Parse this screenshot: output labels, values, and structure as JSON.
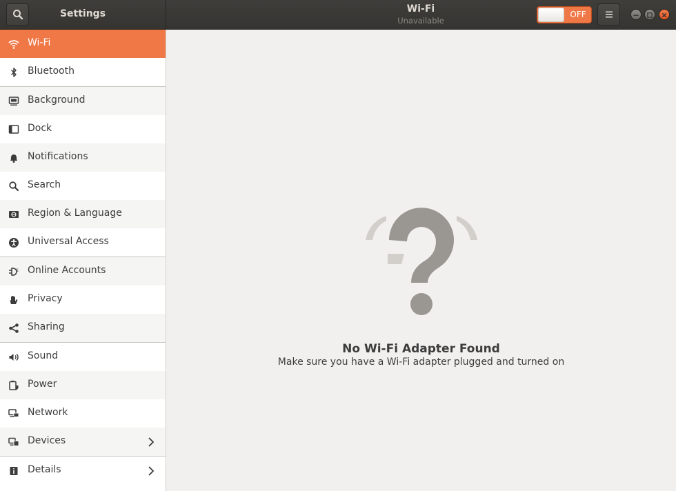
{
  "header": {
    "app_title": "Settings",
    "panel_title": "Wi-Fi",
    "panel_subtitle": "Unavailable",
    "toggle_label": "OFF"
  },
  "sidebar": {
    "items": [
      {
        "label": "Wi-Fi",
        "icon": "wifi-icon"
      },
      {
        "label": "Bluetooth",
        "icon": "bluetooth-icon"
      },
      {
        "label": "Background",
        "icon": "background-icon"
      },
      {
        "label": "Dock",
        "icon": "dock-icon"
      },
      {
        "label": "Notifications",
        "icon": "bell-icon"
      },
      {
        "label": "Search",
        "icon": "search-icon"
      },
      {
        "label": "Region & Language",
        "icon": "region-icon"
      },
      {
        "label": "Universal Access",
        "icon": "accessibility-icon"
      },
      {
        "label": "Online Accounts",
        "icon": "online-accounts-icon"
      },
      {
        "label": "Privacy",
        "icon": "hand-icon"
      },
      {
        "label": "Sharing",
        "icon": "share-icon"
      },
      {
        "label": "Sound",
        "icon": "speaker-icon"
      },
      {
        "label": "Power",
        "icon": "power-icon"
      },
      {
        "label": "Network",
        "icon": "network-icon"
      },
      {
        "label": "Devices",
        "icon": "devices-icon"
      },
      {
        "label": "Details",
        "icon": "info-icon"
      }
    ]
  },
  "main": {
    "empty_title": "No Wi-Fi Adapter Found",
    "empty_message": "Make sure you have a Wi-Fi adapter plugged and turned on"
  },
  "colors": {
    "accent": "#f07746",
    "titlebar": "#3b3a37",
    "icon_gray": "#9a9692"
  }
}
